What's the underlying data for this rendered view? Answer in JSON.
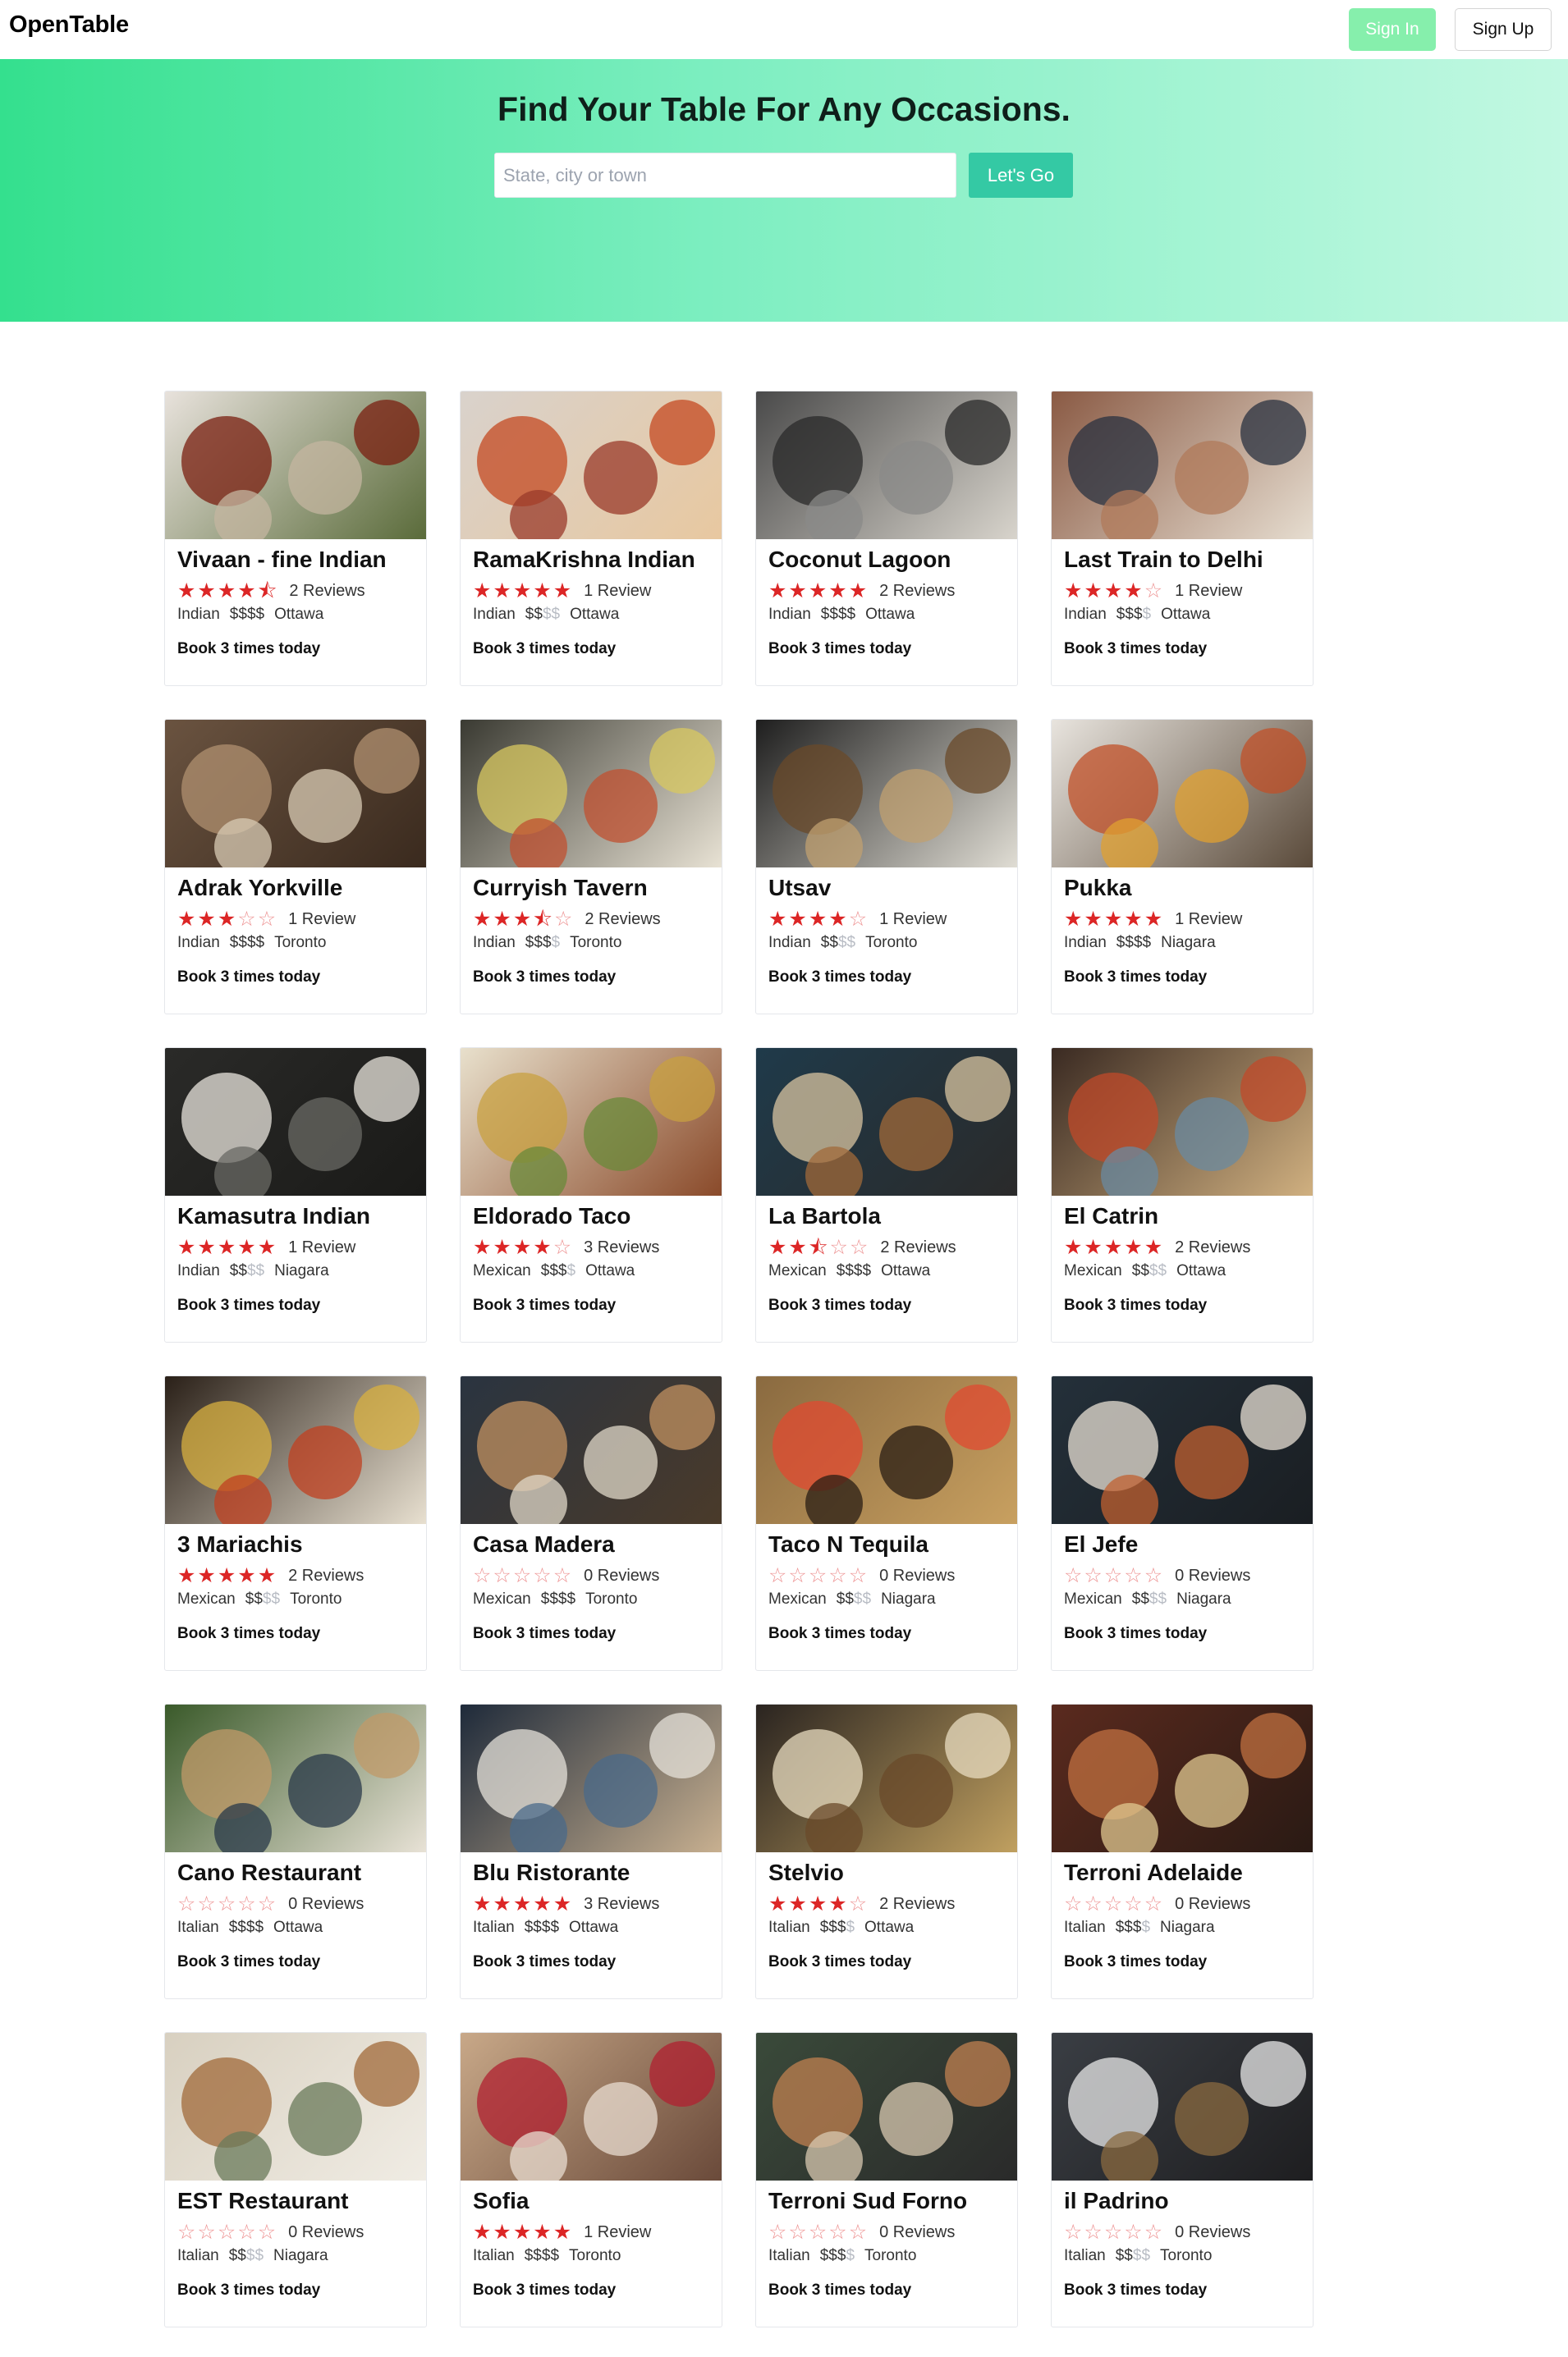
{
  "nav": {
    "logo": "OpenTable",
    "signin_label": "Sign In",
    "signup_label": "Sign Up"
  },
  "hero": {
    "title": "Find Your Table For Any Occasions.",
    "search_placeholder": "State, city or town",
    "search_value": "",
    "go_label": "Let's Go"
  },
  "colors": {
    "accent": "#34e08e",
    "star": "#dc2626",
    "go": "#34c9a4",
    "signin": "#86efac"
  },
  "restaurants": [
    {
      "name": "Vivaan - fine Indian",
      "rating": 4.5,
      "reviews": "2 Reviews",
      "cuisine": "Indian",
      "price": 4,
      "city": "Ottawa",
      "booking": "Book 3 times today",
      "img": [
        "#e8e2dc",
        "#7a1f10",
        "#c4b5a0",
        "#5a6b3a"
      ]
    },
    {
      "name": "RamaKrishna Indian",
      "rating": 5,
      "reviews": "1 Review",
      "cuisine": "Indian",
      "price": 2,
      "city": "Ottawa",
      "booking": "Book 3 times today",
      "img": [
        "#d9d2cc",
        "#c44a22",
        "#9a3a2a",
        "#e8c8a0"
      ]
    },
    {
      "name": "Coconut Lagoon",
      "rating": 5,
      "reviews": "2 Reviews",
      "cuisine": "Indian",
      "price": 4,
      "city": "Ottawa",
      "booking": "Book 3 times today",
      "img": [
        "#4a4a4a",
        "#2a2a2a",
        "#8a8a88",
        "#d8d4cc"
      ]
    },
    {
      "name": "Last Train to Delhi",
      "rating": 4,
      "reviews": "1 Review",
      "cuisine": "Indian",
      "price": 3,
      "city": "Ottawa",
      "booking": "Book 3 times today",
      "img": [
        "#8a5a44",
        "#2a3240",
        "#b07a5a",
        "#e6ddd0"
      ]
    },
    {
      "name": "Adrak Yorkville",
      "rating": 3,
      "reviews": "1 Review",
      "cuisine": "Indian",
      "price": 4,
      "city": "Toronto",
      "booking": "Book 3 times today",
      "img": [
        "#6a5340",
        "#b09070",
        "#d8cbb4",
        "#3a2a1e"
      ]
    },
    {
      "name": "Curryish Tavern",
      "rating": 3.5,
      "reviews": "2 Reviews",
      "cuisine": "Indian",
      "price": 3,
      "city": "Toronto",
      "booking": "Book 3 times today",
      "img": [
        "#3a3a32",
        "#d8c860",
        "#c05030",
        "#e8e2d4"
      ]
    },
    {
      "name": "Utsav",
      "rating": 4,
      "reviews": "1 Review",
      "cuisine": "Indian",
      "price": 2,
      "city": "Toronto",
      "booking": "Book 3 times today",
      "img": [
        "#1e1e1e",
        "#6a4a2a",
        "#c0a070",
        "#e0ddd4"
      ]
    },
    {
      "name": "Pukka",
      "rating": 5,
      "reviews": "1 Review",
      "cuisine": "Indian",
      "price": 4,
      "city": "Niagara",
      "booking": "Book 3 times today",
      "img": [
        "#e8e4de",
        "#c05028",
        "#e0a030",
        "#5a4a3a"
      ]
    },
    {
      "name": "Kamasutra Indian",
      "rating": 5,
      "reviews": "1 Review",
      "cuisine": "Indian",
      "price": 2,
      "city": "Niagara",
      "booking": "Book 3 times today",
      "img": [
        "#2a2a28",
        "#eae6de",
        "#6a6a64",
        "#1a1a18"
      ]
    },
    {
      "name": "Eldorado Taco",
      "rating": 4,
      "reviews": "3 Reviews",
      "cuisine": "Mexican",
      "price": 3,
      "city": "Ottawa",
      "booking": "Book 3 times today",
      "img": [
        "#e8e0cc",
        "#c8a040",
        "#6a8a3a",
        "#8a4a2a"
      ]
    },
    {
      "name": "La Bartola",
      "rating": 2.5,
      "reviews": "2 Reviews",
      "cuisine": "Mexican",
      "price": 4,
      "city": "Ottawa",
      "booking": "Book 3 times today",
      "img": [
        "#1f3a4a",
        "#d8c4a0",
        "#a06a3a",
        "#2a2a2a"
      ]
    },
    {
      "name": "El Catrin",
      "rating": 5,
      "reviews": "2 Reviews",
      "cuisine": "Mexican",
      "price": 2,
      "city": "Ottawa",
      "booking": "Book 3 times today",
      "img": [
        "#3a2a22",
        "#c04a2a",
        "#6a8aa0",
        "#d0b080"
      ]
    },
    {
      "name": "3 Mariachis",
      "rating": 5,
      "reviews": "2 Reviews",
      "cuisine": "Mexican",
      "price": 2,
      "city": "Toronto",
      "booking": "Book 3 times today",
      "img": [
        "#2a2018",
        "#d8b040",
        "#c04020",
        "#e8e0d0"
      ]
    },
    {
      "name": "Casa Madera",
      "rating": 0,
      "reviews": "0 Reviews",
      "cuisine": "Mexican",
      "price": 4,
      "city": "Toronto",
      "booking": "Book 3 times today",
      "img": [
        "#2a3440",
        "#c09060",
        "#e0d8c8",
        "#4a3a2a"
      ]
    },
    {
      "name": "Taco N Tequila",
      "rating": 0,
      "reviews": "0 Reviews",
      "cuisine": "Mexican",
      "price": 2,
      "city": "Niagara",
      "booking": "Book 3 times today",
      "img": [
        "#8a6a40",
        "#e04a30",
        "#2a1e14",
        "#c8a060"
      ]
    },
    {
      "name": "El Jefe",
      "rating": 0,
      "reviews": "0 Reviews",
      "cuisine": "Mexican",
      "price": 2,
      "city": "Niagara",
      "booking": "Book 3 times today",
      "img": [
        "#24303a",
        "#e8e0d4",
        "#c06030",
        "#1a1e22"
      ]
    },
    {
      "name": "Cano Restaurant",
      "rating": 0,
      "reviews": "0 Reviews",
      "cuisine": "Italian",
      "price": 4,
      "city": "Ottawa",
      "booking": "Book 3 times today",
      "img": [
        "#3a5a2a",
        "#c09a68",
        "#2a3a4a",
        "#e8e2d6"
      ]
    },
    {
      "name": "Blu Ristorante",
      "rating": 5,
      "reviews": "3 Reviews",
      "cuisine": "Italian",
      "price": 4,
      "city": "Ottawa",
      "booking": "Book 3 times today",
      "img": [
        "#1e2a3a",
        "#e6e2da",
        "#4a6a8a",
        "#c8b090"
      ]
    },
    {
      "name": "Stelvio",
      "rating": 4,
      "reviews": "2 Reviews",
      "cuisine": "Italian",
      "price": 3,
      "city": "Ottawa",
      "booking": "Book 3 times today",
      "img": [
        "#2a2420",
        "#e8dcc0",
        "#6a4a2a",
        "#c0a060"
      ]
    },
    {
      "name": "Terroni Adelaide",
      "rating": 0,
      "reviews": "0 Reviews",
      "cuisine": "Italian",
      "price": 3,
      "city": "Niagara",
      "booking": "Book 3 times today",
      "img": [
        "#5a2a1e",
        "#c07040",
        "#e0c890",
        "#2a1a14"
      ]
    },
    {
      "name": "EST Restaurant",
      "rating": 0,
      "reviews": "0 Reviews",
      "cuisine": "Italian",
      "price": 2,
      "city": "Niagara",
      "booking": "Book 3 times today",
      "img": [
        "#d8d0c0",
        "#a06a3a",
        "#6a7a5a",
        "#f0ece4"
      ]
    },
    {
      "name": "Sofia",
      "rating": 5,
      "reviews": "1 Review",
      "cuisine": "Italian",
      "price": 4,
      "city": "Toronto",
      "booking": "Book 3 times today",
      "img": [
        "#c8a888",
        "#b02030",
        "#e8dcd0",
        "#6a4a3a"
      ]
    },
    {
      "name": "Terroni Sud Forno",
      "rating": 0,
      "reviews": "0 Reviews",
      "cuisine": "Italian",
      "price": 3,
      "city": "Toronto",
      "booking": "Book 3 times today",
      "img": [
        "#3a4a3a",
        "#c08050",
        "#d8c8b0",
        "#2a2a2a"
      ]
    },
    {
      "name": "il Padrino",
      "rating": 0,
      "reviews": "0 Reviews",
      "cuisine": "Italian",
      "price": 2,
      "city": "Toronto",
      "booking": "Book 3 times today",
      "img": [
        "#3a3e44",
        "#e8e8e8",
        "#8a6a40",
        "#1e1e20"
      ]
    }
  ]
}
